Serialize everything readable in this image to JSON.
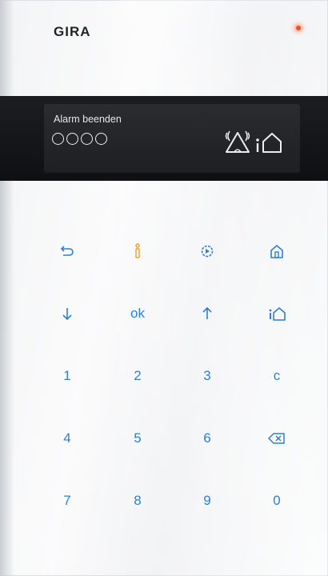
{
  "brand": "GIRA",
  "display": {
    "status": "Alarm beenden",
    "pin_dots": 4,
    "icons": [
      "alarm-bell-icon",
      "info-home-icon"
    ]
  },
  "keypad": {
    "row1": [
      {
        "icon": "back-arrow-icon"
      },
      {
        "icon": "info-icon",
        "color": "#f0a020"
      },
      {
        "icon": "settings-icon"
      },
      {
        "icon": "home-icon"
      }
    ],
    "row2": [
      {
        "icon": "arrow-down-icon"
      },
      {
        "label": "ok"
      },
      {
        "icon": "arrow-up-icon"
      },
      {
        "icon": "info-home-icon"
      }
    ],
    "row3": [
      "1",
      "2",
      "3",
      "c"
    ],
    "row4": [
      "4",
      "5",
      "6"
    ],
    "row4_icon": "backspace-icon",
    "row5": [
      "7",
      "8",
      "9",
      "0"
    ]
  },
  "colors": {
    "key_blue": "#2e7fd6",
    "info_orange": "#f0a020",
    "led_red": "#ff4a1f"
  }
}
